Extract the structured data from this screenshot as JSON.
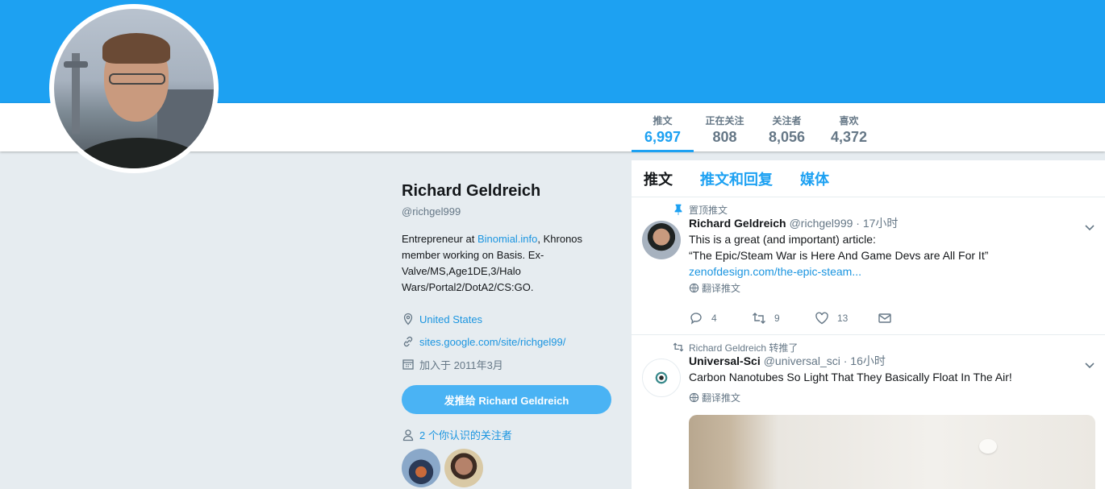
{
  "profile": {
    "name": "Richard Geldreich",
    "handle": "@richgel999",
    "bio_prefix": "Entrepreneur at ",
    "bio_link": "Binomial.info",
    "bio_suffix": ", Khronos member working on Basis. Ex-Valve/MS,Age1DE,3/Halo Wars/Portal2/DotA2/CS:GO.",
    "location": "United States",
    "website": "sites.google.com/site/richgel99/",
    "joined": "加入于 2011年3月",
    "tweet_to_button": "发推给 Richard Geldreich",
    "known_followers": "2 个你认识的关注者"
  },
  "stats": [
    {
      "label": "推文",
      "value": "6,997"
    },
    {
      "label": "正在关注",
      "value": "808"
    },
    {
      "label": "关注者",
      "value": "8,056"
    },
    {
      "label": "喜欢",
      "value": "4,372"
    }
  ],
  "tabs": [
    "推文",
    "推文和回复",
    "媒体"
  ],
  "tweets": [
    {
      "context": "置顶推文",
      "user_name": "Richard Geldreich",
      "screen_name": "@richgel999 · 17小时",
      "text_line1": "This is a great (and important) article:",
      "text_line2": "“The Epic/Steam War is Here And Game Devs are All For It”",
      "link": "zenofdesign.com/the-epic-steam...",
      "translate": "翻译推文",
      "replies": "4",
      "retweets": "9",
      "likes": "13"
    },
    {
      "context": "Richard Geldreich 转推了",
      "user_name": "Universal-Sci",
      "screen_name": "@universal_sci · 16小时",
      "text_line1": "Carbon Nanotubes So Light That They Basically Float In The Air!",
      "translate": "翻译推文"
    }
  ],
  "icons": {
    "location": "map-pin-icon",
    "website": "link-icon",
    "joined": "calendar-icon",
    "known_followers": "person-icon",
    "pin": "pin-icon",
    "retweet": "retweet-icon",
    "reply": "reply-icon",
    "like": "heart-icon",
    "dm": "envelope-icon",
    "caret": "chevron-down-icon",
    "globe": "globe-icon"
  },
  "colors": {
    "banner": "#1da1f2",
    "link": "#1b95e0",
    "button": "#4ab3f4",
    "background": "#e6ecf0"
  }
}
